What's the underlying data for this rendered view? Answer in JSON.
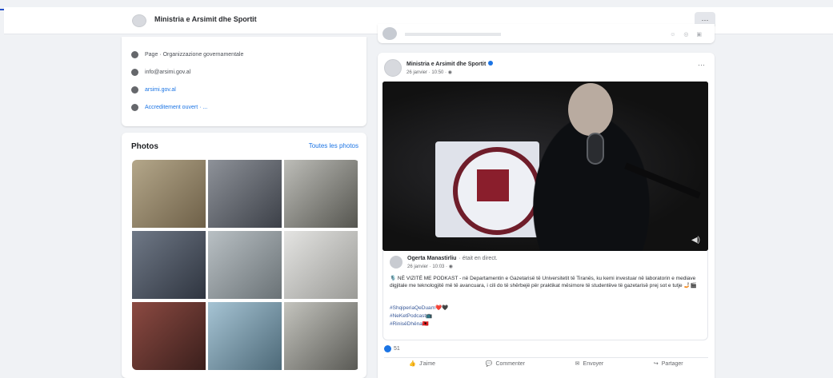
{
  "header": {
    "page_name": "Ministria e Arsimit dhe Sportit",
    "more_label": "···"
  },
  "about": {
    "items": [
      {
        "icon": "info-icon",
        "text": "Page · Organizzazione governamentale"
      },
      {
        "icon": "mail-icon",
        "text": "info@arsimi.gov.al"
      },
      {
        "icon": "globe-icon",
        "text": "arsimi.gov.al"
      },
      {
        "icon": "star-icon",
        "text": "Accreditement ouvert · ..."
      }
    ]
  },
  "photos": {
    "title": "Photos",
    "see_all": "Toutes les photos",
    "tile_colors": [
      "#9b8a6e",
      "#7a7e86",
      "#8c8c88",
      "#5b6472",
      "#9aa0a4",
      "#c9c9c6",
      "#6b3a34",
      "#7fa0b2",
      "#9c9c96"
    ]
  },
  "post": {
    "author": "Ministria e Arsimit dhe Sportit",
    "date": "26 janvier · 10:50 · ◉",
    "menu": "···",
    "shared": {
      "author": "Ogerta Manastirliu",
      "author_extra": "· était en direct.",
      "date": "26 janvier · 10:03 · ◉",
      "body": "🎙️ NË VIZITË ME PODKAST - në Departamentin e Gazetarisë të Universitetit të Tiranës, ku kemi investuar në laboratorin e mediave digjitale me teknologjitë më të avancuara, i cili do të shërbejë për praktikat mësimore të studentëve të gazetarisë prej sot e tutje 🤳🏻🎬",
      "hashtags": [
        "#ShqiperiaQeDuam❤️🖤",
        "#NeKetPodcast📺",
        "#RinisëDhëna🇦🇱"
      ]
    },
    "reactions_count": "51",
    "actions": [
      {
        "icon": "like-icon",
        "label": "J'aime"
      },
      {
        "icon": "comment-icon",
        "label": "Commenter"
      },
      {
        "icon": "share-icon",
        "label": "Envoyer"
      },
      {
        "icon": "forward-icon",
        "label": "Partager"
      }
    ]
  }
}
